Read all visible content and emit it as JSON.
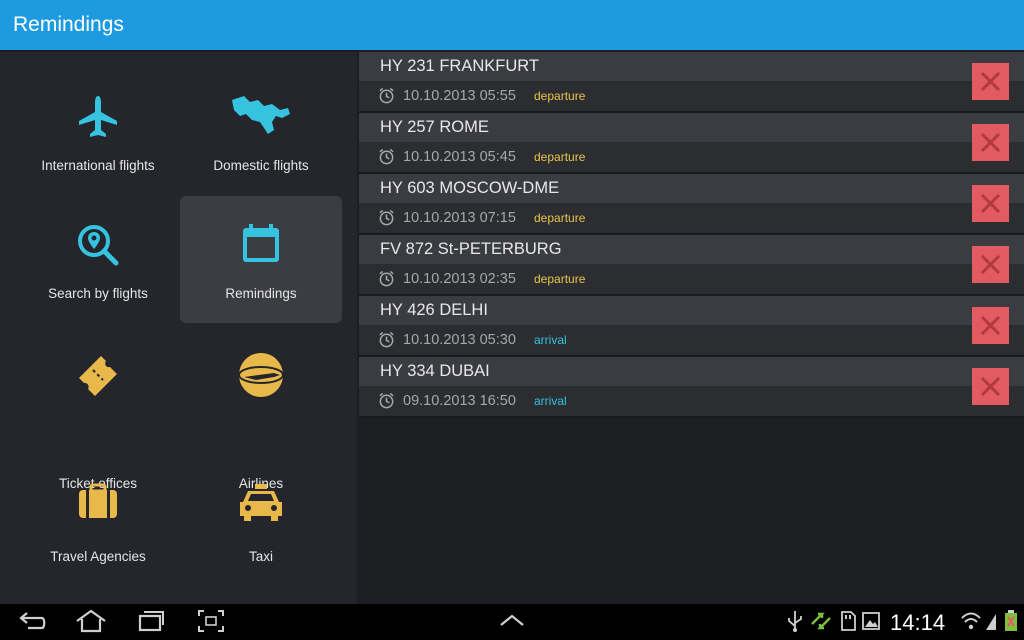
{
  "app": {
    "title": "Remindings"
  },
  "menu": {
    "items": [
      {
        "label": "International flights",
        "icon": "airplane-icon"
      },
      {
        "label": "Domestic flights",
        "icon": "map-icon"
      },
      {
        "label": "Search by flights",
        "icon": "search-location-icon"
      },
      {
        "label": "Remindings",
        "icon": "calendar-icon",
        "active": true
      },
      {
        "label": "Ticket offices",
        "icon": "ticket-icon"
      },
      {
        "label": "Airlines",
        "icon": "airline-globe-icon"
      },
      {
        "label": "Travel Agencies",
        "icon": "suitcase-icon"
      },
      {
        "label": "Taxi",
        "icon": "taxi-icon"
      }
    ]
  },
  "reminders": [
    {
      "flight": "HY 231 FRANKFURT",
      "datetime": "10.10.2013 05:55",
      "type": "departure"
    },
    {
      "flight": "HY 257 ROME",
      "datetime": "10.10.2013 05:45",
      "type": "departure"
    },
    {
      "flight": "HY 603 MOSCOW-DME",
      "datetime": "10.10.2013 07:15",
      "type": "departure"
    },
    {
      "flight": "FV 872 St-PETERBURG",
      "datetime": "10.10.2013 02:35",
      "type": "departure"
    },
    {
      "flight": "HY 426 DELHI",
      "datetime": "10.10.2013 05:30",
      "type": "arrival"
    },
    {
      "flight": "HY 334 DUBAI",
      "datetime": "09.10.2013 16:50",
      "type": "arrival"
    }
  ],
  "colors": {
    "accent": "#1e9be0",
    "icon_blue": "#35c3df",
    "icon_yellow": "#e8b84a",
    "departure": "#e8c44a",
    "arrival": "#35c3df",
    "delete": "#e25b61"
  },
  "statusbar": {
    "time": "14:14"
  }
}
